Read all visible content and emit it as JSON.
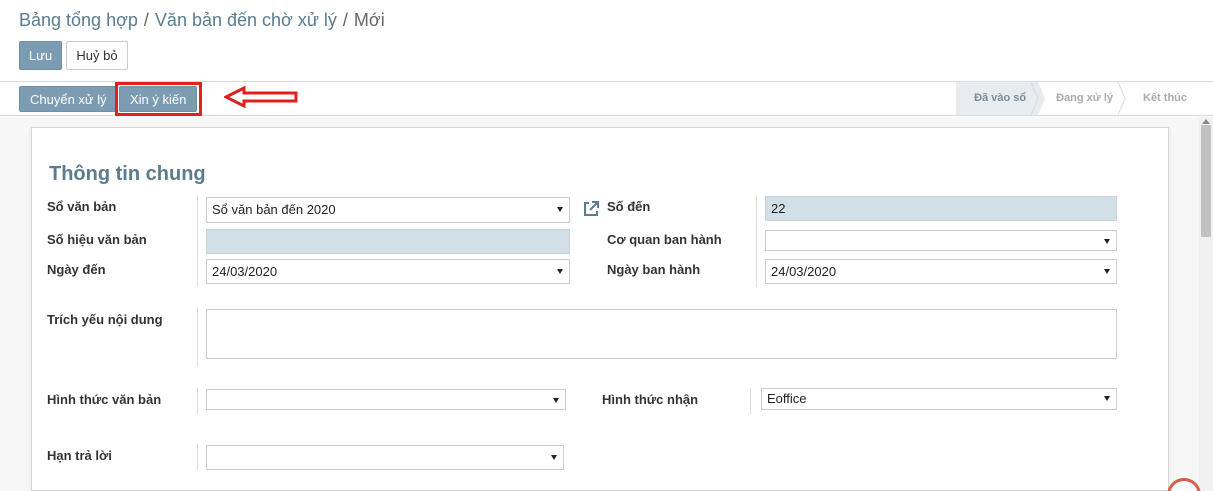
{
  "breadcrumb": {
    "items": [
      "Bảng tổng hợp",
      "Văn bản đến chờ xử lý"
    ],
    "current": "Mới",
    "separator": "/"
  },
  "toolbar": {
    "save_label": "Lưu",
    "cancel_label": "Huỷ bỏ"
  },
  "statusbar": {
    "forward_label": "Chuyển xử lý",
    "consult_label": "Xin ý kiến",
    "stages": [
      {
        "label": "Đã vào sổ",
        "active": true
      },
      {
        "label": "Đang xử lý",
        "active": false
      },
      {
        "label": "Kết thúc",
        "active": false
      }
    ]
  },
  "form": {
    "section_title": "Thông tin chung",
    "fields": {
      "so_van_ban": {
        "label": "Sổ văn bản",
        "value": "Sổ văn bản đến 2020"
      },
      "so_den": {
        "label": "Số đến",
        "value": "22"
      },
      "so_hieu_van_ban": {
        "label": "Số hiệu văn bản",
        "value": ""
      },
      "co_quan_ban_hanh": {
        "label": "Cơ quan ban hành",
        "value": ""
      },
      "ngay_den": {
        "label": "Ngày đến",
        "value": "24/03/2020"
      },
      "ngay_ban_hanh": {
        "label": "Ngày ban hành",
        "value": "24/03/2020"
      },
      "trich_yeu": {
        "label": "Trích yếu nội dung",
        "value": ""
      },
      "hinh_thuc_van_ban": {
        "label": "Hình thức văn bản",
        "value": ""
      },
      "hinh_thuc_nhan": {
        "label": "Hình thức nhận",
        "value": "Eoffice"
      },
      "han_tra_loi": {
        "label": "Hạn trả lời",
        "value": ""
      }
    }
  },
  "colors": {
    "primary": "#7c9cb3",
    "title": "#5a7c8f",
    "readonly_field": "#d2dfe6",
    "annotation": "#e02020"
  }
}
